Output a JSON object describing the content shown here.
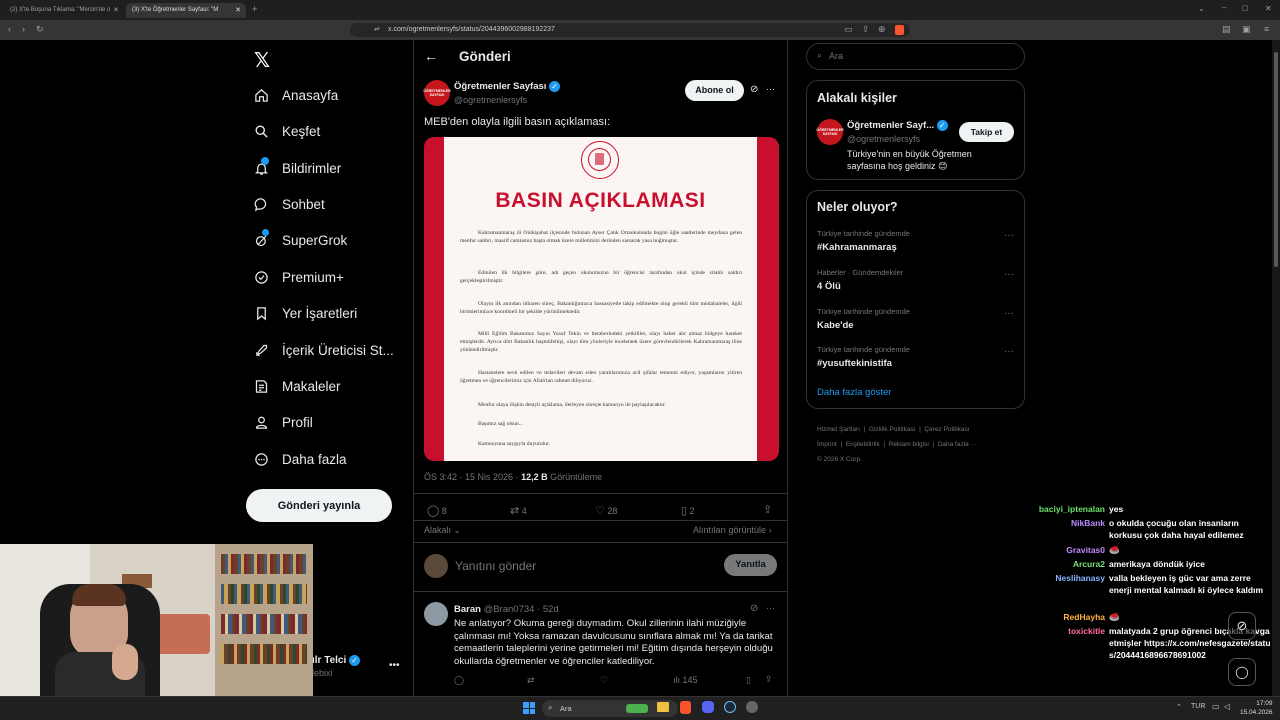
{
  "browser": {
    "tabs": [
      {
        "label": "(2) X'te Boşuna Tıklama: \"Mersin'de o"
      },
      {
        "label": "(3) X'te Öğretmenler Sayfası: \"M"
      }
    ],
    "url": "x.com/ogretmenlersyfs/status/2044396002988192237"
  },
  "nav": {
    "items": [
      {
        "label": "Anasayfa"
      },
      {
        "label": "Keşfet"
      },
      {
        "label": "Bildirimler"
      },
      {
        "label": "Sohbet"
      },
      {
        "label": "SuperGrok"
      },
      {
        "label": "Premium+"
      },
      {
        "label": "Yer İşaretleri"
      },
      {
        "label": "İçerik Üreticisi St..."
      },
      {
        "label": "Makaleler"
      },
      {
        "label": "Profil"
      },
      {
        "label": "Daha fazla"
      }
    ],
    "post_button": "Gönderi yayınla",
    "account_name": "ılr Telci",
    "account_handle": "lebixi"
  },
  "post": {
    "header_title": "Gönderi",
    "author_name": "Öğretmenler Sayfası",
    "author_handle": "@ogretmenlersyfs",
    "avatar_text": "ÖĞRETMENLER SAYFASI",
    "subscribe_label": "Abone ol",
    "text": "MEB'den olayla ilgili basın açıklaması:",
    "image": {
      "heading": "BASIN AÇIKLAMASI",
      "paragraphs": [
        "Kahramanmaraş ili Onikişubat ilçesinde bulunan Ayser Çalık Ortaokulunda bugün öğle saatlerinde meydana gelen menfur saldırı, maarif camiamız başta olmak üzere milletimizi derinden sarsarak yasa boğmuştur.",
        "Edinilen ilk bilgilere göre, adı geçen okulumuzun bir öğrencisi tarafından okul içinde silahlı saldırı gerçekleştirilmiştir.",
        "Olayın ilk anından itibaren süreç, Bakanlığımızca hassasiyetle takip edilmekte olup gerekli tüm müdahaleler, ilgili birimlerimizce koordineli bir şekilde yürütülmektedir.",
        "Milli Eğitim Bakanımız Sayın Yusuf Tekin ve beraberindeki yetkililer, olayı haber alır almaz bölgeye hareket etmişlerdir. Ayrıca dört Bakanlık başmüfettişi, olayı tüm yönleriyle incelemek üzere görevlendirilerek Kahramanmaraş iline yönlendirilmiştir.",
        "Hastanelere sevk edilen ve tedavileri devam eden yaralılarımıza acil şifalar temenni ediyor, yaşamlarını yitiren öğretmen ve öğrencilerimiz için Allah'tan rahmet diliyoruz.",
        "Menfur olaya ilişkin detaylı açıklama, ilerleyen süreçte kamuoyu ile paylaşılacaktır.",
        "Başımız sağ olsun...",
        "Kamuoyuna saygıyla duyurulur."
      ]
    },
    "time": "ÖS 3:42 · 15 Nis 2026 ·",
    "views_count": "12,2 B",
    "views_label": "Görüntüleme",
    "stats": {
      "replies": "8",
      "reposts": "4",
      "likes": "28",
      "bookmarks": "2"
    },
    "relevant_label": "Alakalı",
    "quotes_label": "Alıntıları görüntüle",
    "reply_placeholder": "Yanıtını gönder",
    "reply_button": "Yanıtla"
  },
  "reply": {
    "name": "Baran",
    "handle": "@Bran0734 · 52d",
    "text": "Ne anlatıyor? Okuma gereği duymadım. Okul zillerinin ilahi müziğiyle çalınması mı! Yoksa ramazan davulcusunu sınıflara almak mı! Ya da tarikat cemaatlerin taleplerini yerine getirmeleri mi! Eğitim dışında herşeyin olduğu okullarda öğretmenler ve öğrenciler katlediliyor.",
    "views": "145"
  },
  "search": {
    "placeholder": "Ara"
  },
  "related": {
    "title": "Alakalı kişiler",
    "name": "Öğretmenler Sayf...",
    "handle": "@ogretmenlersyfs",
    "follow_label": "Takip et",
    "bio": "Türkiye'nin en büyük Öğretmen sayfasına hoş geldiniz 😊"
  },
  "trends": {
    "title": "Neler oluyor?",
    "items": [
      {
        "meta": "Türkiye tarihinde gündemde",
        "title": "#Kahramanmaraş"
      },
      {
        "meta": "Haberler · Gündemdekiler",
        "title": "4 Ölü"
      },
      {
        "meta": "Türkiye tarihinde gündemde",
        "title": "Kabe'de"
      },
      {
        "meta": "Türkiye tarihinde gündemde",
        "title": "#yusuftekinistifa"
      }
    ],
    "show_more": "Daha fazla göster"
  },
  "footer": {
    "line1": [
      "Hizmet Şartları",
      "Gizlilik Politikası",
      "Çerez Politikası"
    ],
    "line2": [
      "İmprint",
      "Erişilebilirlik",
      "Reklam bilgisi",
      "Daha fazla ···"
    ],
    "copyright": "© 2026 X Corp."
  },
  "chat": [
    {
      "user": "baciyi_iptenalan",
      "msg": "yes",
      "color": "#6ee36e"
    },
    {
      "user": "NikBank",
      "msg": "o okulda çocuğu olan insanların korkusu çok daha hayal edilemez",
      "color": "#b88cff"
    },
    {
      "user": "Gravitas0",
      "msg": "🥌",
      "color": "#c08aff"
    },
    {
      "user": "Arcura2",
      "msg": "amerikaya döndük iyice",
      "color": "#7ae07a"
    },
    {
      "user": "Neslihanasy",
      "msg": "valla bekleyen iş güc var ama zerre enerji mental kalmadı ki öylece kaldım",
      "color": "#8ab4ff"
    },
    {
      "user": "RedHayha",
      "msg": "🥌",
      "color": "#ffb347"
    },
    {
      "user": "toxickitle",
      "msg": "malatyada 2 grup öğrenci bıçakla kavga etmişler https://x.com/nefesgazete/status/2044416896678691002",
      "color": "#ff6b9a"
    }
  ],
  "taskbar": {
    "search": "Ara",
    "lang": "TUR",
    "time": "17:09",
    "date": "15.04.2026"
  }
}
